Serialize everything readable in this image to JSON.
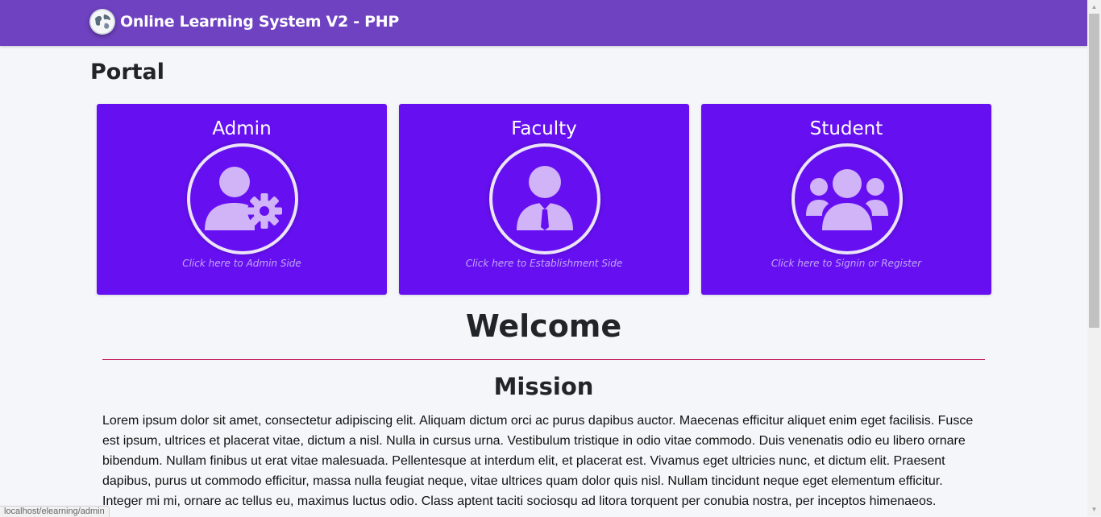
{
  "header": {
    "title": "Online Learning System V2 - PHP",
    "logo_icon": "globe-logo-icon",
    "background": "#6f42c1"
  },
  "portal": {
    "title": "Portal",
    "cards": [
      {
        "title": "Admin",
        "caption": "Click here to Admin Side",
        "icon": "user-gear-icon"
      },
      {
        "title": "Faculty",
        "caption": "Click here to Establishment Side",
        "icon": "user-tie-icon"
      },
      {
        "title": "Student",
        "caption": "Click here to Signin or Register",
        "icon": "users-group-icon"
      }
    ],
    "card_color": "#6610f2",
    "icon_color": "#d1b3f7"
  },
  "welcome": {
    "title": "Welcome",
    "divider_color": "#c2185b"
  },
  "mission": {
    "title": "Mission",
    "text": "Lorem ipsum dolor sit amet, consectetur adipiscing elit. Aliquam dictum orci ac purus dapibus auctor. Maecenas efficitur aliquet enim eget facilisis. Fusce est ipsum, ultrices et placerat vitae, dictum a nisl. Nulla in cursus urna. Vestibulum tristique in odio vitae commodo. Duis venenatis odio eu libero ornare bibendum. Nullam finibus ut erat vitae malesuada. Pellentesque at interdum elit, et placerat est. Vivamus eget ultricies nunc, et dictum elit. Praesent dapibus, purus ut commodo efficitur, massa nulla feugiat neque, vitae ultrices quam dolor quis nisl. Nullam tincidunt neque eget elementum efficitur. Integer mi mi, ornare ac tellus eu, maximus luctus odio. Class aptent taciti sociosqu ad litora torquent per conubia nostra, per inceptos himenaeos."
  },
  "statusbar": {
    "url": "localhost/elearning/admin"
  }
}
